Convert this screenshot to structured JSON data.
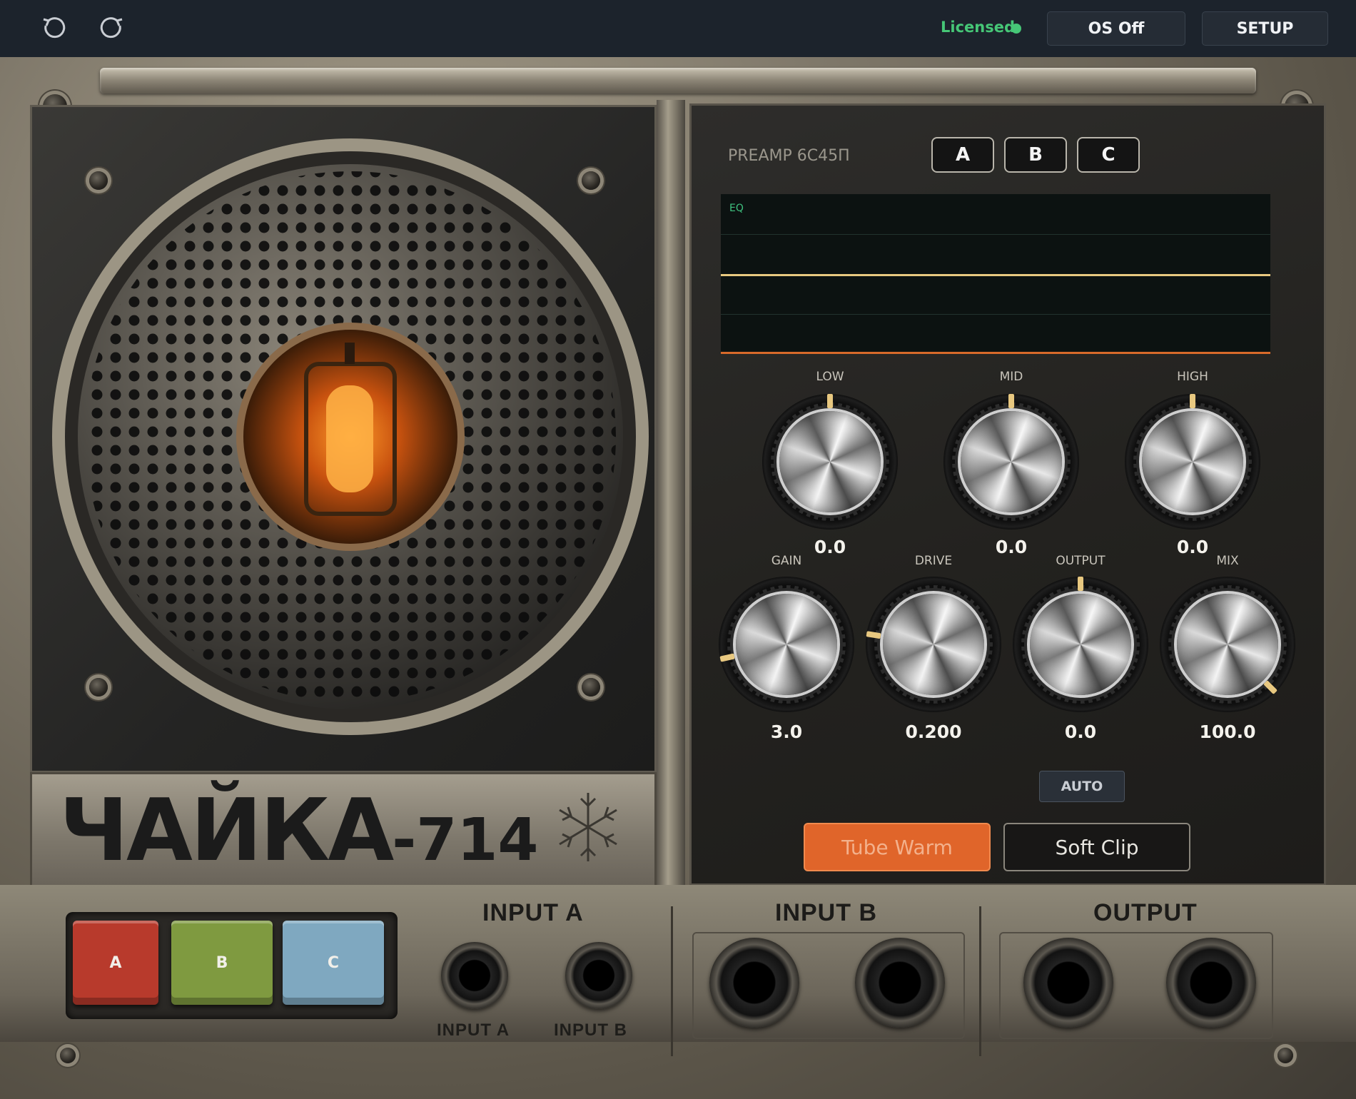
{
  "toolbar": {
    "undo_icon": "undo-icon",
    "redo_icon": "redo-icon",
    "license_status": "Licensed",
    "os_button": "OS Off",
    "setup_button": "SETUP"
  },
  "speaker": {
    "name": "ЧАЙКА",
    "model_number": "-714",
    "emblem_icon": "snowflake-icon"
  },
  "controls": {
    "preamp_label": "PREAMP 6С45П",
    "presets": [
      "A",
      "B",
      "C"
    ],
    "eq": {
      "label": "EQ"
    },
    "eq_knobs": [
      {
        "label": "LOW",
        "value": "0.0",
        "normalized": 0.5
      },
      {
        "label": "MID",
        "value": "0.0",
        "normalized": 0.5
      },
      {
        "label": "HIGH",
        "value": "0.0",
        "normalized": 0.5
      }
    ],
    "main_knobs": [
      {
        "label": "GAIN",
        "value": "3.0",
        "normalized": 0.12
      },
      {
        "label": "DRIVE",
        "value": "0.200",
        "normalized": 0.2
      },
      {
        "label": "OUTPUT",
        "value": "0.0",
        "normalized": 0.5
      },
      {
        "label": "MIX",
        "value": "100.0",
        "normalized": 1.0
      }
    ],
    "auto_button": "AUTO",
    "modes": [
      {
        "label": "Tube Warm",
        "active": true
      },
      {
        "label": "Soft Clip",
        "active": false
      }
    ]
  },
  "bottom": {
    "channel_keys": [
      "A",
      "B",
      "C"
    ],
    "input_a_title": "INPUT A",
    "input_a_sub_labels": [
      "INPUT A",
      "INPUT B"
    ],
    "input_b_title": "INPUT B",
    "output_title": "OUTPUT"
  },
  "colors": {
    "licensed": "#46c777",
    "accent": "#e0652a",
    "eq_line": "#e8c880",
    "key_a": "#b83a2c",
    "key_b": "#7f9a40",
    "key_c": "#7fa8c0"
  }
}
